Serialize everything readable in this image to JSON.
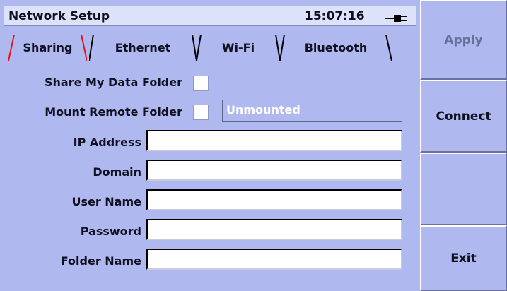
{
  "window": {
    "title": "Network Setup",
    "time": "15:07:16",
    "power_icon": "plug-icon"
  },
  "tabs": [
    {
      "label": "Sharing",
      "active": true
    },
    {
      "label": "Ethernet",
      "active": false
    },
    {
      "label": "Wi-Fi",
      "active": false
    },
    {
      "label": "Bluetooth",
      "active": false
    }
  ],
  "form": {
    "share_label": "Share My Data Folder",
    "share_checked": false,
    "mount_label": "Mount Remote Folder",
    "mount_checked": false,
    "mount_status": "Unmounted",
    "ip_label": "IP Address",
    "ip_value": "",
    "domain_label": "Domain",
    "domain_value": "",
    "user_label": "User Name",
    "user_value": "",
    "password_label": "Password",
    "password_value": "",
    "folder_label": "Folder Name",
    "folder_value": ""
  },
  "softkeys": {
    "apply": "Apply",
    "connect": "Connect",
    "empty": "",
    "exit": "Exit"
  },
  "colors": {
    "background": "#b0b8f0",
    "titlebar": "#dde2fb",
    "active_tab_outline": "#e01818"
  }
}
